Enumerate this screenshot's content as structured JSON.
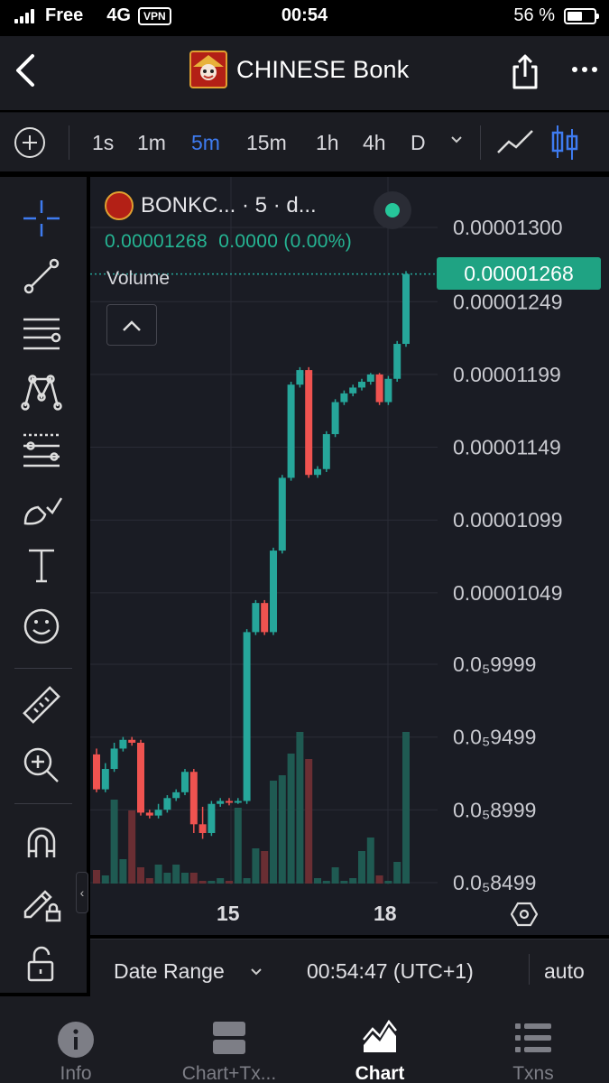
{
  "status_bar": {
    "carrier": "Free",
    "network": "4G",
    "vpn": "VPN",
    "time": "00:54",
    "battery": "56 %",
    "battery_level": 0.56
  },
  "nav": {
    "back_icon": "chevron-left-icon",
    "title": "CHINESE Bonk",
    "share_icon": "share-icon",
    "more_icon": "more-horizontal-icon"
  },
  "timeframes": {
    "items": [
      "1s",
      "1m",
      "5m",
      "15m",
      "1h",
      "4h",
      "D"
    ],
    "active": "5m"
  },
  "chart_header": {
    "symbol": "BONKC... · 5 · d...",
    "price_line": "0.00001268  0.0000 (0.00%)",
    "volume_label": "Volume",
    "current_price_tag": "0.00001268"
  },
  "footer": {
    "date_range": "Date Range",
    "clock": "00:54:47 (UTC+1)",
    "scale_mode": "auto"
  },
  "tabs": [
    {
      "label": "Info",
      "icon": "info-icon"
    },
    {
      "label": "Chart+Tx...",
      "icon": "split-view-icon"
    },
    {
      "label": "Chart",
      "icon": "area-chart-icon"
    },
    {
      "label": "Txns",
      "icon": "list-icon"
    }
  ],
  "left_tools": [
    "crosshair-icon",
    "trend-line-icon",
    "fib-retracement-icon",
    "pattern-icon",
    "prediction-icon",
    "brush-icon",
    "text-icon",
    "emoji-icon",
    "ruler-icon",
    "zoom-in-icon",
    "magnet-icon",
    "lock-drawing-icon",
    "unlock-icon"
  ],
  "chart_data": {
    "type": "candlestick",
    "y_axis_labels": [
      "0.00001300",
      "0.00001249",
      "0.00001199",
      "0.00001149",
      "0.00001099",
      "0.00001049",
      "0.0₅9999",
      "0.0₅9499",
      "0.0₅8999",
      "0.0₅8499"
    ],
    "y_axis_values": [
      1.3e-05,
      1.249e-05,
      1.199e-05,
      1.149e-05,
      1.099e-05,
      1.049e-05,
      9.999e-06,
      9.499e-06,
      8.999e-06,
      8.499e-06
    ],
    "x_axis_labels": [
      "15",
      "18"
    ],
    "up_color": "#26a69a",
    "down_color": "#ef5350",
    "candles": [
      {
        "o": 9.38,
        "c": 9.14,
        "h": 9.42,
        "l": 9.12
      },
      {
        "o": 9.14,
        "c": 9.28,
        "h": 9.32,
        "l": 9.12
      },
      {
        "o": 9.28,
        "c": 9.42,
        "h": 9.46,
        "l": 9.26
      },
      {
        "o": 9.42,
        "c": 9.48,
        "h": 9.5,
        "l": 9.4
      },
      {
        "o": 9.48,
        "c": 9.46,
        "h": 9.5,
        "l": 9.44
      },
      {
        "o": 9.46,
        "c": 8.98,
        "h": 9.48,
        "l": 8.96
      },
      {
        "o": 8.98,
        "c": 8.96,
        "h": 9.0,
        "l": 8.94
      },
      {
        "o": 8.96,
        "c": 9.0,
        "h": 9.04,
        "l": 8.94
      },
      {
        "o": 9.0,
        "c": 9.08,
        "h": 9.1,
        "l": 8.98
      },
      {
        "o": 9.08,
        "c": 9.12,
        "h": 9.14,
        "l": 9.06
      },
      {
        "o": 9.12,
        "c": 9.26,
        "h": 9.28,
        "l": 9.1
      },
      {
        "o": 9.26,
        "c": 8.9,
        "h": 9.28,
        "l": 8.84
      },
      {
        "o": 8.9,
        "c": 8.84,
        "h": 9.02,
        "l": 8.8
      },
      {
        "o": 8.84,
        "c": 9.04,
        "h": 9.06,
        "l": 8.82
      },
      {
        "o": 9.04,
        "c": 9.06,
        "h": 9.08,
        "l": 9.02
      },
      {
        "o": 9.06,
        "c": 9.05,
        "h": 9.08,
        "l": 9.03
      },
      {
        "o": 9.05,
        "c": 9.06,
        "h": 9.08,
        "l": 9.04
      },
      {
        "o": 9.06,
        "c": 10.22,
        "h": 10.24,
        "l": 9.04
      },
      {
        "o": 10.22,
        "c": 10.42,
        "h": 10.44,
        "l": 10.2
      },
      {
        "o": 10.42,
        "c": 10.22,
        "h": 10.44,
        "l": 10.2
      },
      {
        "o": 10.22,
        "c": 10.78,
        "h": 10.8,
        "l": 10.2
      },
      {
        "o": 10.78,
        "c": 11.28,
        "h": 11.3,
        "l": 10.76
      },
      {
        "o": 11.28,
        "c": 11.92,
        "h": 11.94,
        "l": 11.26
      },
      {
        "o": 11.92,
        "c": 12.02,
        "h": 12.04,
        "l": 11.9
      },
      {
        "o": 12.02,
        "c": 11.3,
        "h": 12.04,
        "l": 11.28
      },
      {
        "o": 11.3,
        "c": 11.34,
        "h": 11.36,
        "l": 11.28
      },
      {
        "o": 11.34,
        "c": 11.58,
        "h": 11.6,
        "l": 11.32
      },
      {
        "o": 11.58,
        "c": 11.8,
        "h": 11.82,
        "l": 11.56
      },
      {
        "o": 11.8,
        "c": 11.86,
        "h": 11.88,
        "l": 11.78
      },
      {
        "o": 11.86,
        "c": 11.9,
        "h": 11.92,
        "l": 11.84
      },
      {
        "o": 11.9,
        "c": 11.94,
        "h": 11.96,
        "l": 11.88
      },
      {
        "o": 11.94,
        "c": 11.99,
        "h": 12.0,
        "l": 11.92
      },
      {
        "o": 11.99,
        "c": 11.8,
        "h": 12.0,
        "l": 11.78
      },
      {
        "o": 11.8,
        "c": 11.96,
        "h": 11.98,
        "l": 11.78
      },
      {
        "o": 11.96,
        "c": 12.2,
        "h": 12.22,
        "l": 11.94
      },
      {
        "o": 12.2,
        "c": 12.68,
        "h": 12.7,
        "l": 12.18
      }
    ],
    "volume": [
      0.5,
      0.3,
      3.1,
      0.9,
      2.7,
      0.6,
      0.2,
      0.7,
      0.4,
      0.7,
      0.4,
      0.4,
      0.1,
      0.1,
      0.2,
      0.1,
      2.8,
      0.2,
      1.3,
      1.2,
      3.8,
      4.0,
      4.8,
      5.6,
      4.6,
      0.2,
      0.1,
      0.6,
      0.1,
      0.2,
      1.2,
      1.7,
      0.3,
      0.1,
      0.8,
      5.6
    ],
    "grid": true
  }
}
